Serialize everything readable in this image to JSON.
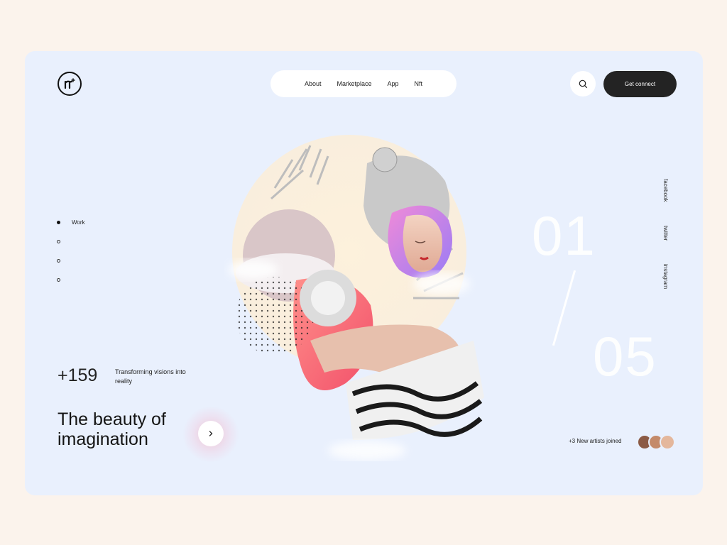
{
  "header": {
    "nav": [
      "About",
      "Marketplace",
      "App",
      "Nft"
    ],
    "cta_label": "Get connect",
    "search_icon": "search-icon",
    "logo_icon": "brand-logo-icon"
  },
  "slider": {
    "items": [
      "Work",
      "",
      "",
      ""
    ],
    "active_index": 0
  },
  "stats": {
    "number": "+159",
    "description": "Transforming visions into reality"
  },
  "hero": {
    "headline": "The beauty of imagination",
    "next_icon": "chevron-right-icon"
  },
  "counter": {
    "current": "01",
    "total": "05"
  },
  "socials": [
    "facebook",
    "twitter",
    "instagram"
  ],
  "artists": {
    "text": "+3 New artists joined"
  },
  "colors": {
    "page_bg": "#fbf3ec",
    "card_bg": "#e9f0fd",
    "cta_bg": "#232323",
    "accent_coral": "#f06b6b",
    "accent_violet": "#b07cf0"
  }
}
